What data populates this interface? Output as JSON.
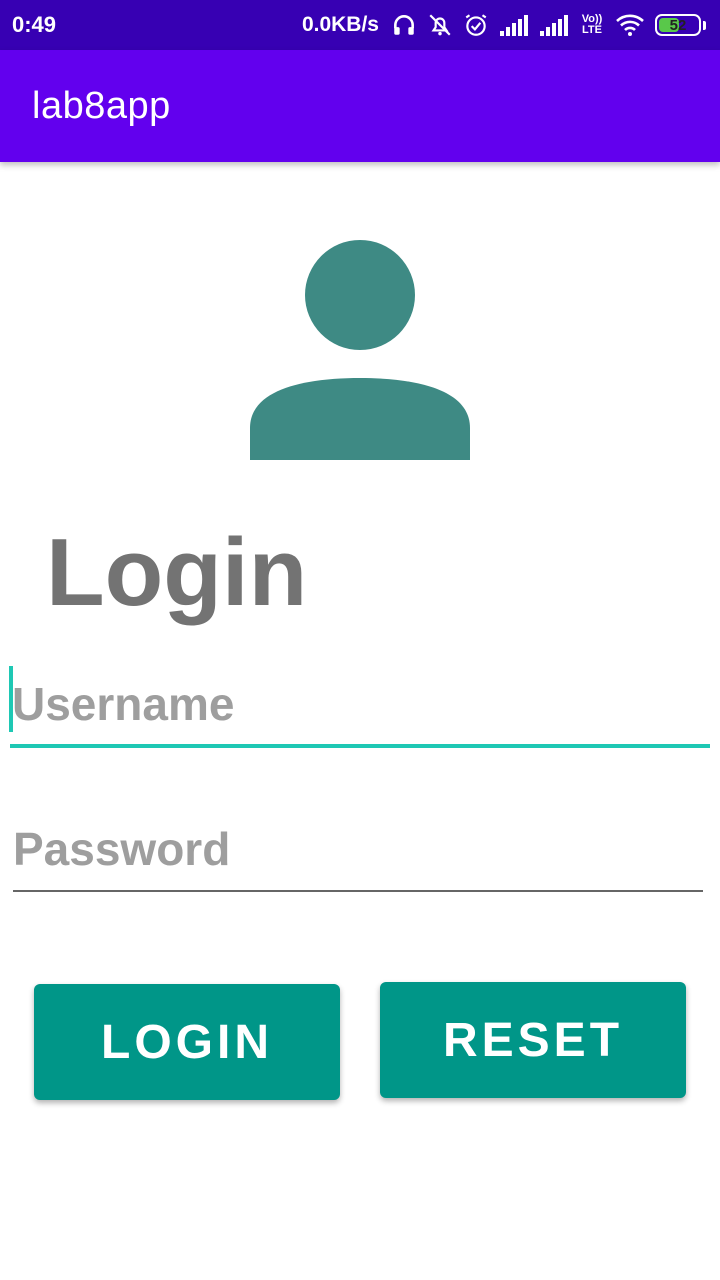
{
  "status_bar": {
    "time": "0:49",
    "network_speed": "0.0KB/s",
    "battery_level": "52",
    "battery_percent": 52,
    "volte_label": "Vo)) LTE",
    "icons": [
      "headphones-icon",
      "notifications-off-icon",
      "alarm-icon",
      "signal-icon",
      "signal-icon",
      "volte-icon",
      "wifi-icon",
      "battery-icon"
    ]
  },
  "app_bar": {
    "title": "lab8app",
    "color": "#6200ee"
  },
  "avatar": {
    "icon": "person-icon",
    "color": "#3e8a84"
  },
  "form": {
    "title": "Login",
    "username_placeholder": "Username",
    "username_value": "",
    "password_placeholder": "Password",
    "password_value": ""
  },
  "buttons": {
    "login_label": "LOGIN",
    "reset_label": "RESET",
    "color": "#009688"
  },
  "colors": {
    "status_bar": "#3700b3",
    "accent": "#1ec8b4",
    "title_text": "#737373",
    "placeholder": "#9e9e9e"
  }
}
